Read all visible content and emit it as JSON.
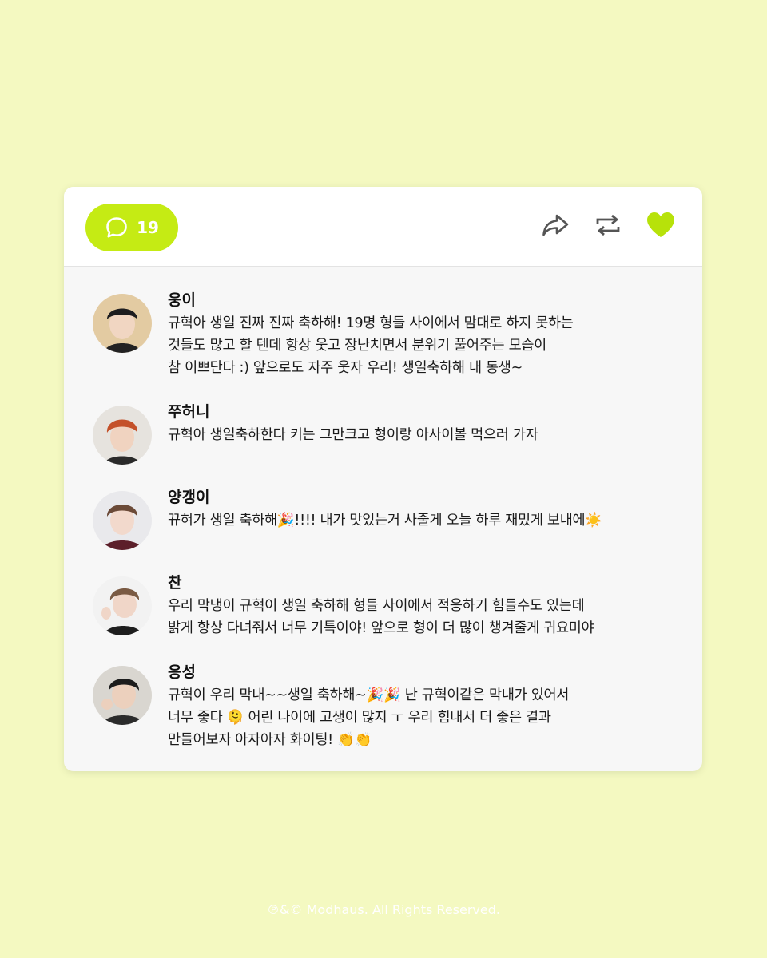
{
  "header": {
    "comment_count": "19",
    "icons": {
      "comment": "speech-bubble-icon",
      "share": "share-arrow-icon",
      "repost": "repost-icon",
      "like": "heart-icon"
    },
    "accent_color": "#c5eb14"
  },
  "comments": [
    {
      "name": "웅이",
      "lines": [
        "규혁아 생일 진짜 진짜 축하해! 19명 형들 사이에서 맘대로 하지 못하는",
        "것들도 많고 할 텐데 항상 웃고 장난치면서 분위기 풀어주는 모습이",
        "참 이쁘단다 :) 앞으로도 자주 웃자 우리! 생일축하해 내 동생~"
      ]
    },
    {
      "name": "쭈허니",
      "lines": [
        "규혁아 생일축하한다 키는 그만크고 형이랑 아사이볼 먹으러 가자"
      ]
    },
    {
      "name": "양갱이",
      "lines": [
        "뀨혀가 생일 축하해🎉!!!! 내가 맛있는거 사줄게 오늘 하루 재밌게 보내에☀️"
      ]
    },
    {
      "name": "찬",
      "lines": [
        "우리 막냉이 규혁이 생일 축하해 형들 사이에서 적응하기 힘들수도 있는데",
        "밝게 항상 다녀줘서 너무 기특이야! 앞으로 형이 더 많이 챙겨줄게 귀요미야"
      ]
    },
    {
      "name": "응성",
      "lines": [
        "규혁이 우리 막내~~생일 축하해~🎉🎉 난 규혁이같은 막내가 있어서",
        "너무 좋다 🫠 어린 나이에 고생이 많지 ㅜ 우리 힘내서 더 좋은 결과",
        "만들어보자 아자아자 화이팅! 👏👏"
      ]
    }
  ],
  "footer": "℗&© Modhaus. All Rights Reserved."
}
